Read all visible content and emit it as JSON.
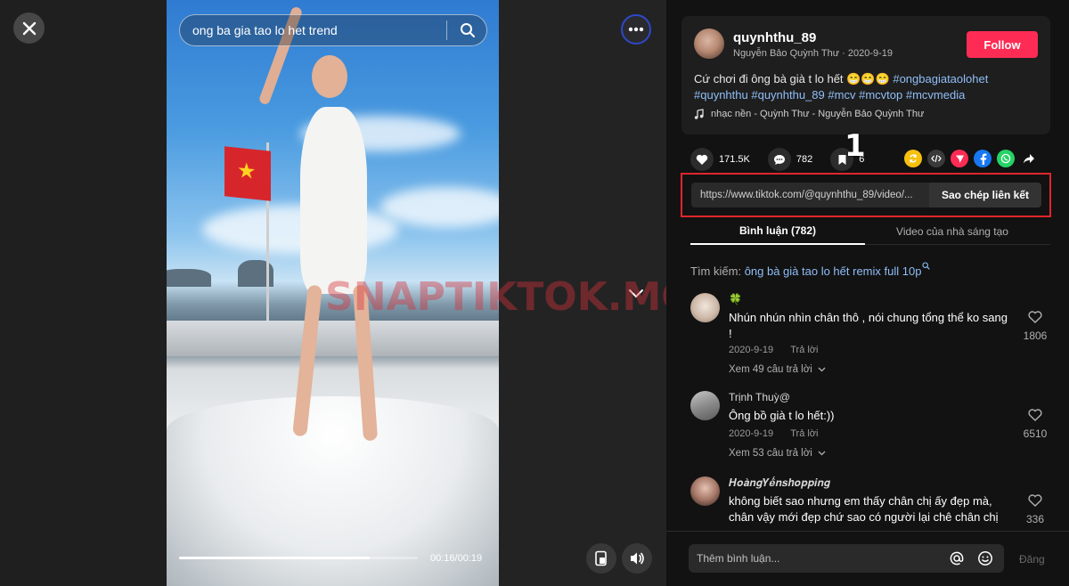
{
  "search": {
    "value": "ong ba gia tao lo het trend",
    "icon": "search-icon"
  },
  "player": {
    "watermark": "SNAPTIKTOK.MOBI",
    "time": "00:16/00:19",
    "progress": 0.8,
    "flag_star": "★"
  },
  "post": {
    "username": "quynhthu_89",
    "nickname": "Nguyễn Bảo Quỳnh Thư",
    "separator": "·",
    "date": "2020-9-19",
    "follow_label": "Follow",
    "caption_text": "Cứ chơi đi ông bà già t lo hết 😁😁😁",
    "hashtags": [
      "#ongbagiataolohet",
      "#quynhthu",
      "#quynhthu_89",
      "#mcv",
      "#mcvtop",
      "#mcvmedia"
    ],
    "music": "nhạc nền - Quỳnh Thư - Nguyễn Bảo Quỳnh Thư"
  },
  "actions": {
    "likes": "171.5K",
    "comments": "782",
    "saves": "6",
    "annotation": "1"
  },
  "share": {
    "link": "https://www.tiktok.com/@quynhthu_89/video/...",
    "copy_label": "Sao chép liên kết",
    "icons": [
      "repost-icon",
      "embed-icon",
      "send-icon",
      "facebook-icon",
      "whatsapp-icon",
      "share-arrow-icon"
    ]
  },
  "tabs": [
    {
      "label": "Bình luận (782)",
      "active": true
    },
    {
      "label": "Video của nhà sáng tạo",
      "active": false
    }
  ],
  "related": {
    "prefix": "Tìm kiếm:",
    "query": "ông bà già tao lo hết remix full 10p"
  },
  "comments": [
    {
      "name": "🍀",
      "text": "Nhún nhún nhìn chân thô , nói chung tổng thể ko sang !",
      "date": "2020-9-19",
      "reply": "Trả lời",
      "more": "Xem 49 câu trả lời",
      "likes": "1806"
    },
    {
      "name": "Trịnh Thuỳ@",
      "text": "Ông bồ già t lo hết:))",
      "date": "2020-9-19",
      "reply": "Trả lời",
      "more": "Xem 53 câu trả lời",
      "likes": "6510"
    },
    {
      "name": "𝑯𝒐𝒂̀𝒏𝒈𝒀𝒆̂́𝒏𝒔𝒉𝒐𝒑𝒑𝒊𝒏𝒈",
      "text": "không biết sao nhưng em thấy chân chị ấy đẹp mà, chân vậy mới đẹp chứ sao có người lại chê chân chị",
      "likes": "336"
    }
  ],
  "comment_bar": {
    "placeholder": "Thêm bình luận...",
    "post_label": "Đăng"
  },
  "colors": {
    "follow": "#fe2c55",
    "hashtag": "#8fbef7",
    "highlight": "#e0262c"
  }
}
